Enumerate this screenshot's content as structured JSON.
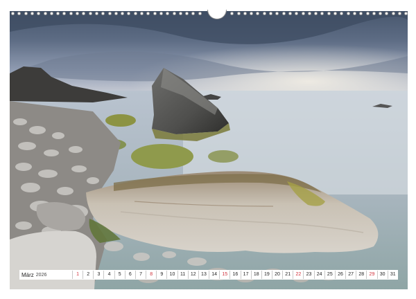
{
  "calendar": {
    "month": "März",
    "year": "2026",
    "days": [
      {
        "n": "1",
        "sun": true
      },
      {
        "n": "2"
      },
      {
        "n": "3"
      },
      {
        "n": "4"
      },
      {
        "n": "5"
      },
      {
        "n": "6"
      },
      {
        "n": "7"
      },
      {
        "n": "8",
        "sun": true
      },
      {
        "n": "9"
      },
      {
        "n": "10"
      },
      {
        "n": "11"
      },
      {
        "n": "12"
      },
      {
        "n": "13"
      },
      {
        "n": "14"
      },
      {
        "n": "15",
        "sun": true
      },
      {
        "n": "16"
      },
      {
        "n": "17"
      },
      {
        "n": "18"
      },
      {
        "n": "19"
      },
      {
        "n": "20"
      },
      {
        "n": "21"
      },
      {
        "n": "22",
        "sun": true
      },
      {
        "n": "23"
      },
      {
        "n": "24"
      },
      {
        "n": "25"
      },
      {
        "n": "26"
      },
      {
        "n": "27"
      },
      {
        "n": "28"
      },
      {
        "n": "29",
        "sun": true
      },
      {
        "n": "30"
      },
      {
        "n": "31"
      }
    ]
  },
  "colors": {
    "sunday": "#d0303a",
    "weekday": "#222222"
  }
}
